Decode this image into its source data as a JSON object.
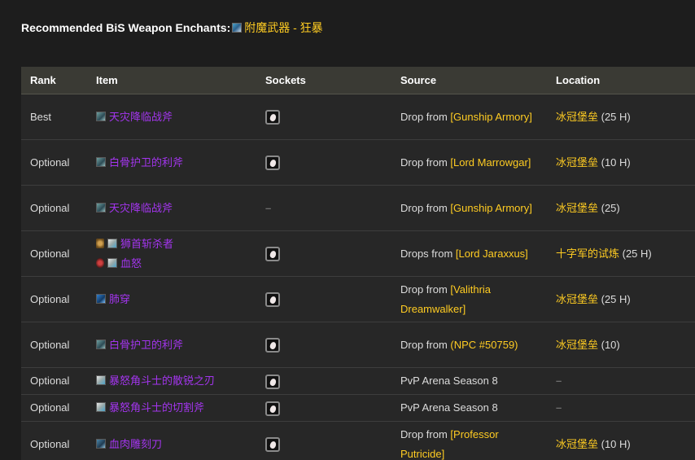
{
  "header": {
    "prefix": "Recommended BiS Weapon Enchants:",
    "enchant_link": "附魔武器 - 狂暴",
    "enchant_icon": "enchant-scroll-icon"
  },
  "table": {
    "columns": [
      "Rank",
      "Item",
      "Sockets",
      "Source",
      "Location"
    ],
    "rows": [
      {
        "rank": "Best",
        "item": "天灾降临战斧",
        "socket_dash": "",
        "src_prefix": "Drop from ",
        "src_link": "[Gunship Armory]",
        "loc_link": "冰冠堡垒",
        "loc_suffix": " (25 H)"
      },
      {
        "rank": "Optional",
        "item": "白骨护卫的利斧",
        "socket_dash": "",
        "src_prefix": "Drop from ",
        "src_link": "[Lord Marrowgar]",
        "loc_link": "冰冠堡垒",
        "loc_suffix": " (10 H)"
      },
      {
        "rank": "Optional",
        "item": "天灾降临战斧",
        "socket_dash": "–",
        "src_prefix": "Drop from ",
        "src_link": "[Gunship Armory]",
        "loc_link": "冰冠堡垒",
        "loc_suffix": " (25)"
      },
      {
        "rank": "Optional",
        "item": "狮首斩杀者",
        "item2": "血怒",
        "socket_dash": "",
        "src_prefix": "Drops from ",
        "src_link": "[Lord Jaraxxus]",
        "loc_link": "十字军的试炼",
        "loc_suffix": " (25 H)"
      },
      {
        "rank": "Optional",
        "item": "肺穿",
        "socket_dash": "",
        "src_prefix": "Drop from ",
        "src_link": "[Valithria Dreamwalker]",
        "loc_link": "冰冠堡垒",
        "loc_suffix": " (25 H)"
      },
      {
        "rank": "Optional",
        "item": "白骨护卫的利斧",
        "socket_dash": "",
        "src_prefix": "Drop from ",
        "src_link": "(NPC #50759)",
        "loc_link": "冰冠堡垒",
        "loc_suffix": " (10)"
      },
      {
        "rank": "Optional",
        "item": "暴怒角斗士的散锐之刃",
        "socket_dash": "",
        "src_text": "PvP Arena Season 8",
        "loc_dash": "–"
      },
      {
        "rank": "Optional",
        "item": "暴怒角斗士的切割斧",
        "socket_dash": "",
        "src_text": "PvP Arena Season 8",
        "loc_dash": "–"
      },
      {
        "rank": "Optional",
        "item": "血肉雕刻刀",
        "socket_dash": "",
        "src_prefix": "Drop from ",
        "src_link": "[Professor Putricide]",
        "loc_link": "冰冠堡垒",
        "loc_suffix": " (10 H)"
      }
    ]
  }
}
